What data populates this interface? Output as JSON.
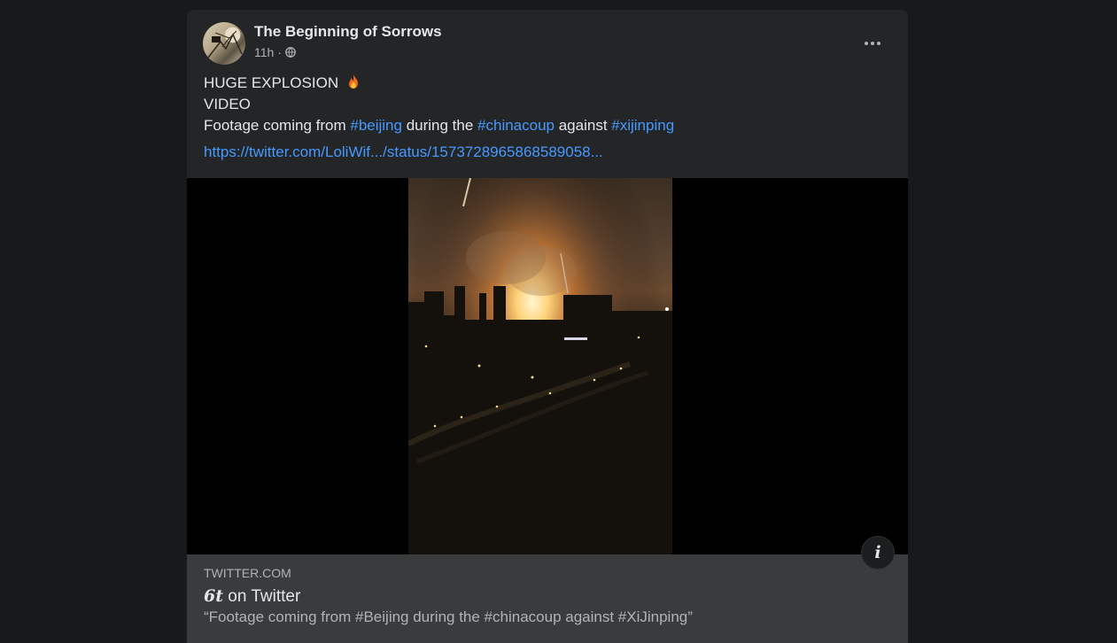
{
  "post": {
    "author": "The Beginning of Sorrows",
    "time": "11h",
    "separator": "·",
    "privacy_icon": "globe-icon",
    "more_icon": "more-horizontal-icon",
    "text": {
      "line1": "HUGE EXPLOSION",
      "line1_icon": "fire-icon",
      "line2": "VIDEO",
      "line3_part1": "Footage coming from ",
      "hashtag1": "#beijing",
      "line3_part2": " during the ",
      "hashtag2": "#chinacoup",
      "line3_part3": " against ",
      "hashtag3": "#xijinping"
    },
    "link_url": "https://twitter.com/LoliWif.../status/1573728965868589058...",
    "media": {
      "info_icon": "info-icon",
      "info_label": "i"
    },
    "link_preview": {
      "domain": "TWITTER.COM",
      "title_handle": "6t",
      "title_rest": " on Twitter",
      "description": "“Footage coming from #Beijing during the #chinacoup against #XiJinping”"
    }
  },
  "colors": {
    "page_bg": "#18191a",
    "card_bg": "#242526",
    "link_blue": "#4599ff",
    "preview_bg": "#3a3b3c"
  }
}
